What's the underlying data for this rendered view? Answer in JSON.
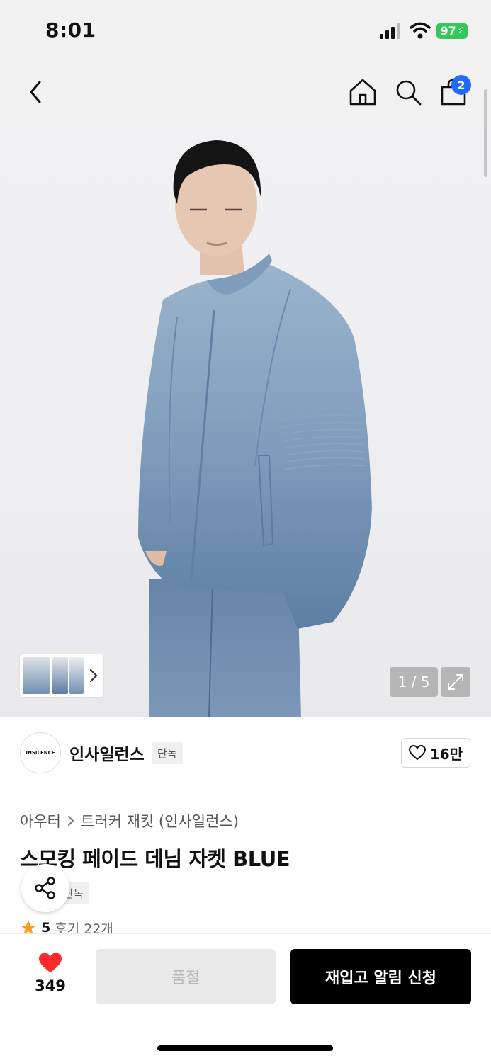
{
  "status_bar": {
    "time": "8:01",
    "battery": "97"
  },
  "header": {
    "cart_count": "2"
  },
  "gallery": {
    "counter": "1 / 5"
  },
  "brand": {
    "logo_text": "INSILENCE",
    "name": "인사일런스",
    "tag": "단독",
    "likes": "16만"
  },
  "product": {
    "breadcrumb": [
      "아우터",
      "트러커 재킷 (인사일런스)"
    ],
    "title": "스모킹 페이드 데님 자켓 BLUE",
    "exclusive_tag": "단독",
    "rating": "5",
    "reviews": "후기 22개"
  },
  "bottom_bar": {
    "wish_count": "349",
    "soldout_label": "품절",
    "restock_label": "재입고 알림 신청"
  },
  "colors": {
    "accent_blue": "#1f6bff",
    "battery_green": "#34c759",
    "heart_red": "#ff2a2a",
    "star_orange": "#ff9a1f"
  }
}
